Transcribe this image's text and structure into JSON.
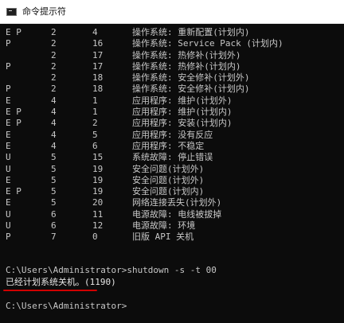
{
  "window": {
    "title": "命令提示符",
    "icon": "cmd-icon"
  },
  "console": {
    "rows": [
      {
        "type": "E P",
        "major": "2",
        "minor": "4",
        "reason": "操作系统: 重新配置(计划内)"
      },
      {
        "type": "P",
        "major": "2",
        "minor": "16",
        "reason": "操作系统: Service Pack (计划内)"
      },
      {
        "type": "",
        "major": "2",
        "minor": "17",
        "reason": "操作系统: 热修补(计划外)"
      },
      {
        "type": "P",
        "major": "2",
        "minor": "17",
        "reason": "操作系统: 热修补(计划内)"
      },
      {
        "type": "",
        "major": "2",
        "minor": "18",
        "reason": "操作系统: 安全修补(计划外)"
      },
      {
        "type": "P",
        "major": "2",
        "minor": "18",
        "reason": "操作系统: 安全修补(计划内)"
      },
      {
        "type": "E",
        "major": "4",
        "minor": "1",
        "reason": "应用程序: 维护(计划外)"
      },
      {
        "type": "E P",
        "major": "4",
        "minor": "1",
        "reason": "应用程序: 维护(计划内)"
      },
      {
        "type": "E P",
        "major": "4",
        "minor": "2",
        "reason": "应用程序: 安装(计划内)"
      },
      {
        "type": "E",
        "major": "4",
        "minor": "5",
        "reason": "应用程序: 没有反应"
      },
      {
        "type": "E",
        "major": "4",
        "minor": "6",
        "reason": "应用程序: 不稳定"
      },
      {
        "type": "U",
        "major": "5",
        "minor": "15",
        "reason": "系统故障: 停止错误"
      },
      {
        "type": "U",
        "major": "5",
        "minor": "19",
        "reason": "安全问题(计划外)"
      },
      {
        "type": "E",
        "major": "5",
        "minor": "19",
        "reason": "安全问题(计划外)"
      },
      {
        "type": "E P",
        "major": "5",
        "minor": "19",
        "reason": "安全问题(计划内)"
      },
      {
        "type": "E",
        "major": "5",
        "minor": "20",
        "reason": "网络连接丢失(计划外)"
      },
      {
        "type": "U",
        "major": "6",
        "minor": "11",
        "reason": "电源故障: 电线被拔掉"
      },
      {
        "type": "U",
        "major": "6",
        "minor": "12",
        "reason": "电源故障: 环境"
      },
      {
        "type": "P",
        "major": "7",
        "minor": "0",
        "reason": "旧版 API 关机"
      }
    ],
    "command_line": "C:\\Users\\Administrator>shutdown -s -t  00",
    "output_line": "已经计划系统关机。(1190)",
    "prompt_line": "C:\\Users\\Administrator>"
  },
  "colors": {
    "console_bg": "#0c0c0c",
    "console_text": "#c7c7c7",
    "highlight_underline": "#d00000"
  }
}
